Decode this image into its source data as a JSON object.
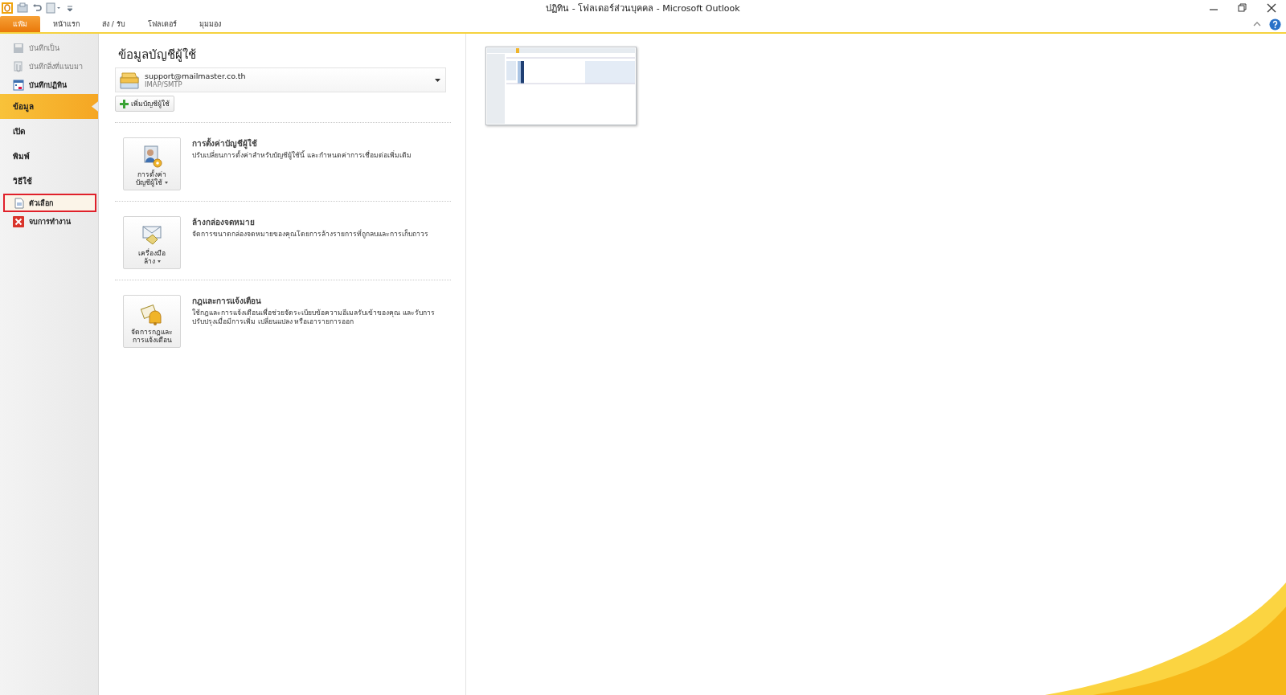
{
  "window": {
    "title": "ปฏิทิน - โฟลเดอร์ส่วนบุคคล - Microsoft Outlook"
  },
  "ribbon_tabs": [
    {
      "label": "แฟ้ม",
      "selected": true
    },
    {
      "label": "หน้าแรก",
      "selected": false
    },
    {
      "label": "ส่ง / รับ",
      "selected": false
    },
    {
      "label": "โฟลเดอร์",
      "selected": false
    },
    {
      "label": "มุมมอง",
      "selected": false
    }
  ],
  "sidebar": {
    "items": [
      {
        "kind": "command",
        "label": "บันทึกเป็น",
        "disabled": true,
        "selected": false,
        "outlined": false
      },
      {
        "kind": "command",
        "label": "บันทึกสิ่งที่แนบมา",
        "disabled": true,
        "selected": false,
        "outlined": false
      },
      {
        "kind": "command",
        "label": "บันทึกปฏิทิน",
        "disabled": false,
        "selected": false,
        "outlined": false
      },
      {
        "kind": "section",
        "label": "ข้อมูล",
        "disabled": false,
        "selected": true,
        "outlined": false
      },
      {
        "kind": "section",
        "label": "เปิด",
        "disabled": false,
        "selected": false,
        "outlined": false
      },
      {
        "kind": "section",
        "label": "พิมพ์",
        "disabled": false,
        "selected": false,
        "outlined": false
      },
      {
        "kind": "section",
        "label": "วิธีใช้",
        "disabled": false,
        "selected": false,
        "outlined": false
      },
      {
        "kind": "command",
        "label": "ตัวเลือก",
        "disabled": false,
        "selected": false,
        "outlined": true
      },
      {
        "kind": "command",
        "label": "จบการทำงาน",
        "disabled": false,
        "selected": false,
        "outlined": false
      }
    ]
  },
  "account_info": {
    "heading": "ข้อมูลบัญชีผู้ใช้",
    "account": {
      "email": "support@mailmaster.co.th",
      "type": "IMAP/SMTP"
    },
    "add_account_button": "เพิ่มบัญชีผู้ใช้",
    "sections": [
      {
        "button_lines": [
          "การตั้งค่า",
          "บัญชีผู้ใช้"
        ],
        "dropdown": true,
        "title": "การตั้งค่าบัญชีผู้ใช้",
        "description": "ปรับเปลี่ยนการตั้งค่าสำหรับบัญชีผู้ใช้นี้ และกำหนดค่าการเชื่อมต่อเพิ่มเติม"
      },
      {
        "button_lines": [
          "เครื่องมือ",
          "ล้าง"
        ],
        "dropdown": true,
        "title": "ล้างกล่องจดหมาย",
        "description": "จัดการขนาดกล่องจดหมายของคุณโดยการล้างรายการที่ถูกลบและการเก็บถาวร"
      },
      {
        "button_lines": [
          "จัดการกฎและ",
          "การแจ้งเตือน"
        ],
        "dropdown": false,
        "title": "กฎและการแจ้งเตือน",
        "description": "ใช้กฎและการแจ้งเตือนเพื่อช่วยจัดระเบียบข้อความอีเมลรับเข้าของคุณ และรับการปรับปรุงเมื่อมีการเพิ่ม เปลี่ยนแปลง หรือเอารายการออก"
      }
    ]
  }
}
